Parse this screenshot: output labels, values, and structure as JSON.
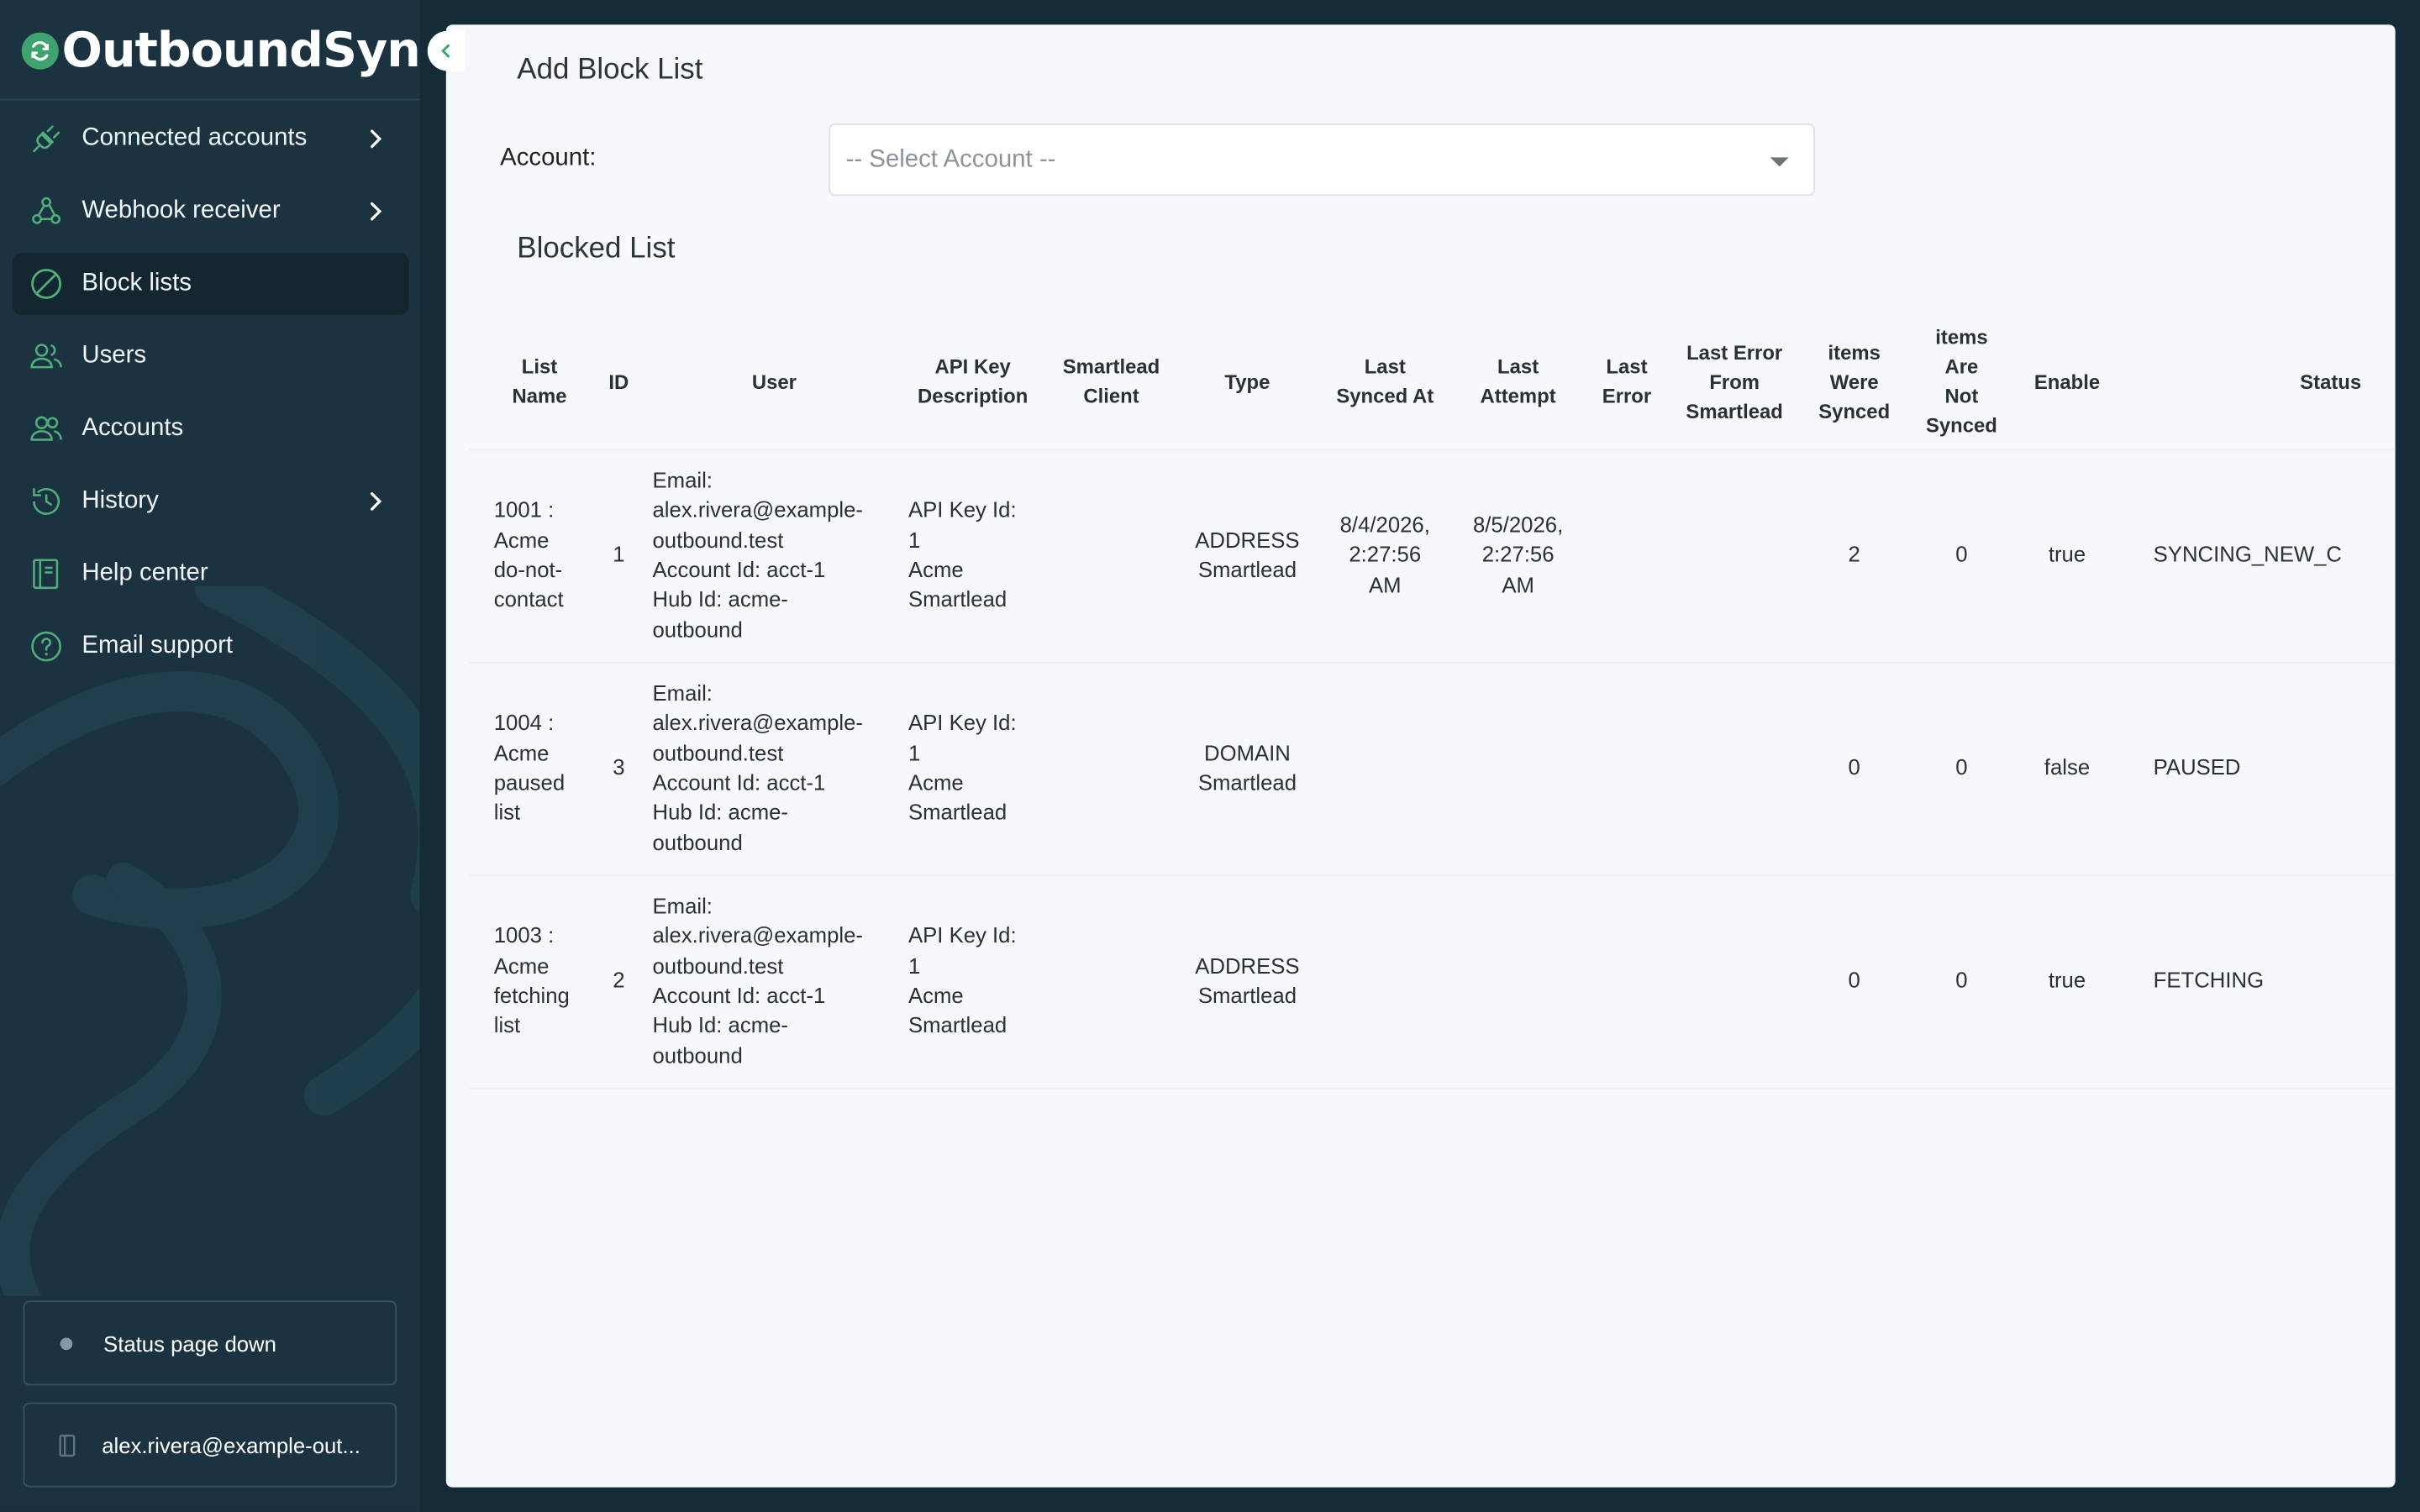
{
  "app": {
    "name": "OutboundSync"
  },
  "nav": [
    {
      "key": "connected",
      "label": "Connected accounts",
      "icon": "plug-icon",
      "chevron": true,
      "active": false
    },
    {
      "key": "webhook",
      "label": "Webhook receiver",
      "icon": "webhook-icon",
      "chevron": true,
      "active": false
    },
    {
      "key": "blocklists",
      "label": "Block lists",
      "icon": "block-icon",
      "chevron": false,
      "active": true
    },
    {
      "key": "users",
      "label": "Users",
      "icon": "users-icon",
      "chevron": false,
      "active": false
    },
    {
      "key": "accounts",
      "label": "Accounts",
      "icon": "accounts-icon",
      "chevron": false,
      "active": false
    },
    {
      "key": "history",
      "label": "History",
      "icon": "history-icon",
      "chevron": true,
      "active": false
    },
    {
      "key": "help",
      "label": "Help center",
      "icon": "book-icon",
      "chevron": false,
      "active": false
    },
    {
      "key": "support",
      "label": "Email support",
      "icon": "question-icon",
      "chevron": false,
      "active": false
    }
  ],
  "status": {
    "text": "Status page down"
  },
  "user": {
    "email": "alex.rivera@example-out..."
  },
  "main": {
    "title": "Add Block List",
    "account_label": "Account:",
    "account_placeholder": "-- Select Account --",
    "table_title": "Blocked List"
  },
  "table": {
    "columns": [
      [
        "List",
        "Name"
      ],
      [
        "ID"
      ],
      [
        "User"
      ],
      [
        "API Key",
        "Description"
      ],
      [
        "Smartlead",
        "Client"
      ],
      [
        "Type"
      ],
      [
        "Last",
        "Synced At"
      ],
      [
        "Last",
        "Attempt"
      ],
      [
        "Last",
        "Error"
      ],
      [
        "Last Error",
        "From",
        "Smartlead"
      ],
      [
        "items",
        "Were",
        "Synced"
      ],
      [
        "items",
        "Are",
        "Not",
        "Synced"
      ],
      [
        "Enable"
      ],
      [
        "Status"
      ]
    ],
    "rows": [
      {
        "name": [
          "1001 :",
          "Acme",
          "do-not-",
          "contact"
        ],
        "id": "1",
        "user": [
          "Email:",
          "alex.rivera@example-",
          "outbound.test",
          "Account Id: acct-1",
          "Hub Id: acme-",
          "outbound"
        ],
        "api": [
          "API Key Id:",
          "1",
          "Acme",
          "Smartlead"
        ],
        "client": "",
        "type": [
          "ADDRESS",
          "Smartlead"
        ],
        "synced": [
          "8/4/2026,",
          "2:27:56",
          "AM"
        ],
        "attempt": [
          "8/5/2026,",
          "2:27:56",
          "AM"
        ],
        "error": "",
        "error_sl": "",
        "were_synced": "2",
        "not_synced": "0",
        "enable": "true",
        "status": "SYNCING_NEW_C"
      },
      {
        "name": [
          "1004 :",
          "Acme",
          "paused",
          "list"
        ],
        "id": "3",
        "user": [
          "Email:",
          "alex.rivera@example-",
          "outbound.test",
          "Account Id: acct-1",
          "Hub Id: acme-",
          "outbound"
        ],
        "api": [
          "API Key Id:",
          "1",
          "Acme",
          "Smartlead"
        ],
        "client": "",
        "type": [
          "DOMAIN",
          "Smartlead"
        ],
        "synced": [],
        "attempt": [],
        "error": "",
        "error_sl": "",
        "were_synced": "0",
        "not_synced": "0",
        "enable": "false",
        "status": "PAUSED"
      },
      {
        "name": [
          "1003 :",
          "Acme",
          "fetching",
          "list"
        ],
        "id": "2",
        "user": [
          "Email:",
          "alex.rivera@example-",
          "outbound.test",
          "Account Id: acct-1",
          "Hub Id: acme-",
          "outbound"
        ],
        "api": [
          "API Key Id:",
          "1",
          "Acme",
          "Smartlead"
        ],
        "client": "",
        "type": [
          "ADDRESS",
          "Smartlead"
        ],
        "synced": [],
        "attempt": [],
        "error": "",
        "error_sl": "",
        "were_synced": "0",
        "not_synced": "0",
        "enable": "true",
        "status": "FETCHING"
      }
    ]
  },
  "colors": {
    "sidebar_bg": "#1b3340",
    "page_bg": "#152b37",
    "accent": "#3fa36f",
    "icon": "#4fae7c",
    "panel_bg": "#f7f8fb"
  }
}
